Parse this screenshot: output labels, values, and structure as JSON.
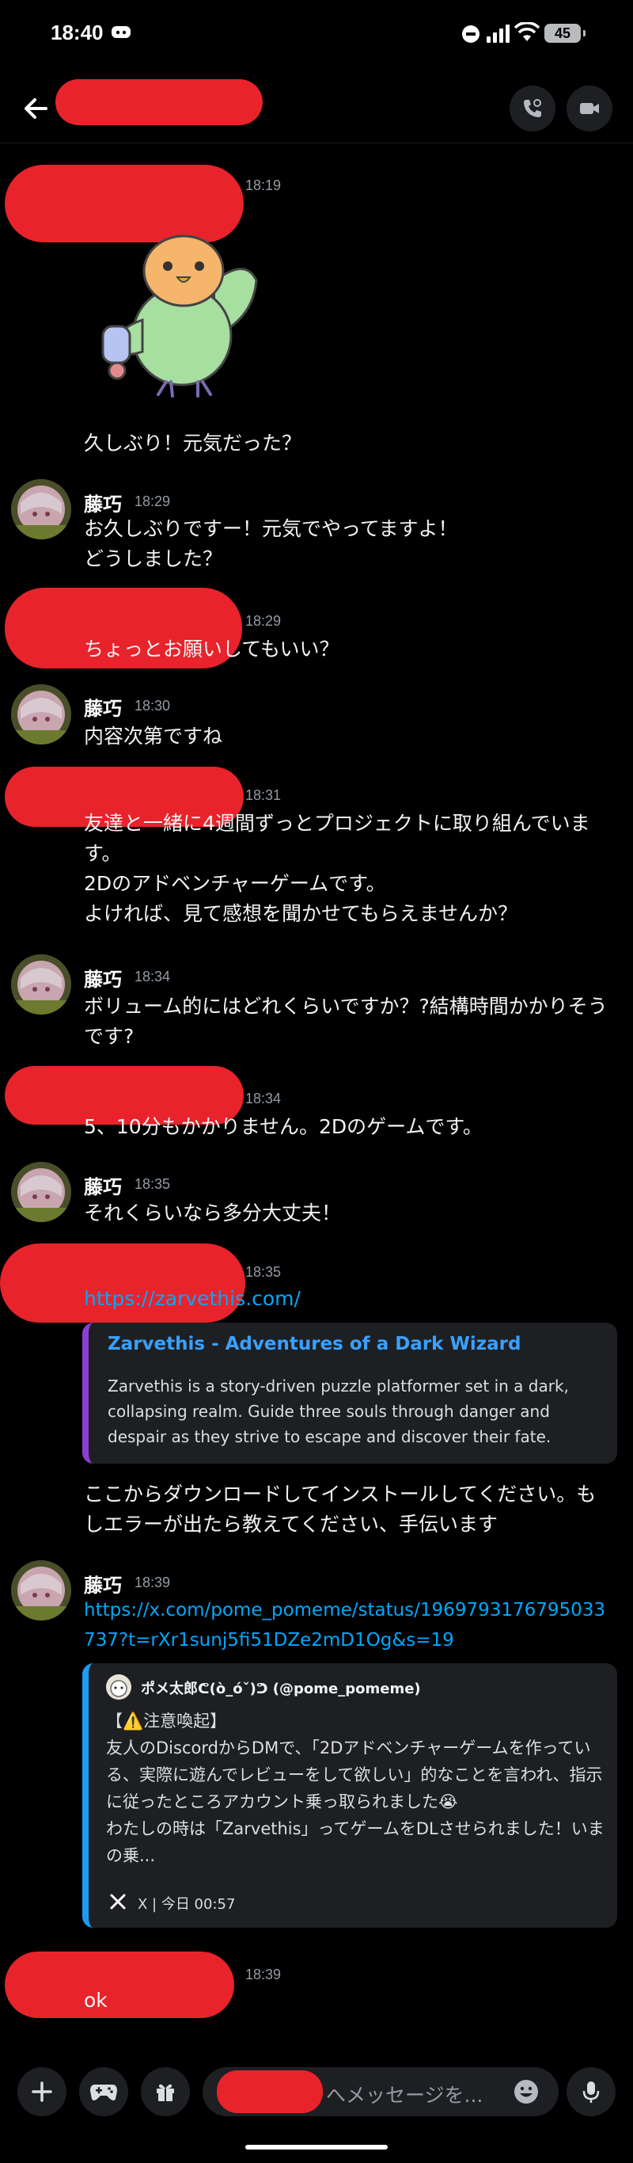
{
  "status_bar": {
    "time": "18:40",
    "battery": "45"
  },
  "messages": [
    {
      "time": "18:19",
      "text": "久しぶり！元気だった？"
    },
    {
      "author": "藤巧",
      "time": "18:29",
      "text": "お久しぶりですー！元気でやってますよ！\nどうしました？"
    },
    {
      "time": "18:29",
      "text": "ちょっとお願いしてもいい？"
    },
    {
      "author": "藤巧",
      "time": "18:30",
      "text": "内容次第ですね"
    },
    {
      "time": "18:31",
      "text": "友達と一緒に4週間ずっとプロジェクトに取り組んでいます。\n2Dのアドベンチャーゲームです。\nよければ、見て感想を聞かせてもらえませんか？"
    },
    {
      "author": "藤巧",
      "time": "18:34",
      "text": "ボリューム的にはどれくらいですか？?結構時間かかりそうです?"
    },
    {
      "time": "18:34",
      "text": "5、10分もかかりません。2Dのゲームです。"
    },
    {
      "author": "藤巧",
      "time": "18:35",
      "text": "それくらいなら多分大丈夫！"
    },
    {
      "time": "18:35",
      "link": "https://zarvethis.com/",
      "embed": {
        "title": "Zarvethis - Adventures of a Dark Wizard",
        "description": "Zarvethis is a story-driven puzzle platformer set in a dark, collapsing realm. Guide three souls through danger and despair as they strive to escape and discover their fate."
      },
      "text": "ここからダウンロードしてインストールしてください。もしエラーが出たら教えてください、手伝います"
    },
    {
      "author": "藤巧",
      "time": "18:39",
      "link": "https://x.com/pome_pomeme/status/1969793176795033737?t=rXr1sunj5fi51DZe2mD1Og&s=19",
      "tweet": {
        "author": "ポメ太郎ᕦ(ò_óˇ)ᕤ (@pome_pomeme)",
        "text": "【⚠️注意喚起】\n友人のDiscordからDMで、「2Dアドベンチャーゲームを作っている、実際に遊んでレビューをして欲しい」的なことを言われ、指示に従ったところアカウント乗っ取られました😭\nわたしの時は「Zarvethis」ってゲームをDLさせられました！いまの乗...",
        "footer": "X | 今日 00:57"
      }
    },
    {
      "time": "18:39",
      "text": "ok"
    }
  ],
  "composer": {
    "placeholder": "へメッセージを..."
  },
  "icons": [
    "back-arrow-icon",
    "voice-call-icon",
    "video-call-icon",
    "plus-icon",
    "gamepad-icon",
    "gift-icon",
    "emoji-icon",
    "microphone-icon",
    "x-logo-icon"
  ],
  "colors": {
    "background": "#000000",
    "link": "#00a8fc",
    "embed_accent": "#8b3fd1",
    "tweet_accent": "#1d9bf0",
    "redaction": "#e8232b"
  }
}
